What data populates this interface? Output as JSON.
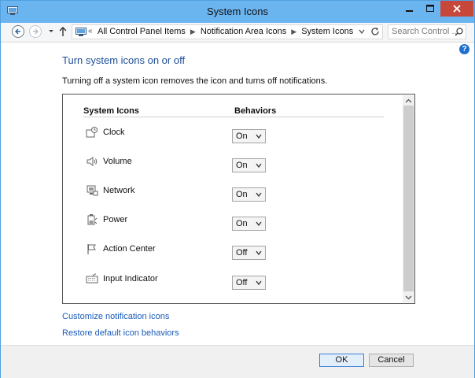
{
  "window": {
    "title": "System Icons"
  },
  "address": {
    "overflow_chevron": "«",
    "breadcrumbs": [
      "All Control Panel Items",
      "Notification Area Icons",
      "System Icons"
    ]
  },
  "search": {
    "placeholder": "Search Control ..."
  },
  "page": {
    "title": "Turn system icons on or off",
    "description": "Turning off a system icon removes the icon and turns off notifications."
  },
  "table": {
    "headers": {
      "icons": "System Icons",
      "behaviors": "Behaviors"
    },
    "rows": [
      {
        "label": "Clock",
        "icon": "clock-icon",
        "behavior": "On"
      },
      {
        "label": "Volume",
        "icon": "volume-icon",
        "behavior": "On"
      },
      {
        "label": "Network",
        "icon": "network-icon",
        "behavior": "On"
      },
      {
        "label": "Power",
        "icon": "power-icon",
        "behavior": "On"
      },
      {
        "label": "Action Center",
        "icon": "action-center-flag-icon",
        "behavior": "Off"
      },
      {
        "label": "Input Indicator",
        "icon": "keyboard-icon",
        "behavior": "Off"
      }
    ]
  },
  "links": {
    "customize": "Customize notification icons",
    "restore": "Restore default icon behaviors"
  },
  "buttons": {
    "ok": "OK",
    "cancel": "Cancel"
  },
  "colors": {
    "titlebar": "#6ab4f0",
    "close_button": "#c7483a",
    "heading_blue": "#1e4e9a",
    "link_blue": "#1a5bb8"
  }
}
